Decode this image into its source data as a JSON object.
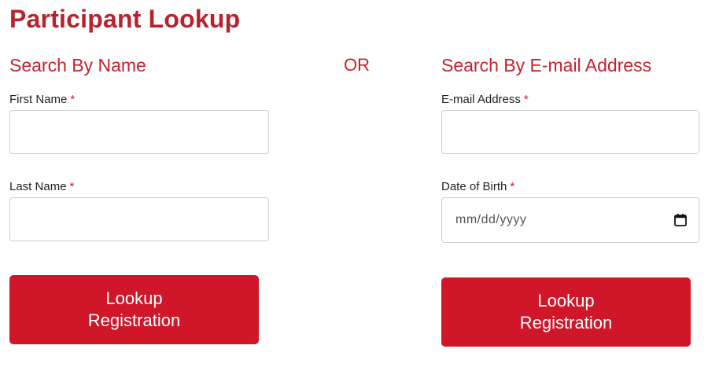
{
  "page": {
    "title": "Participant Lookup",
    "or_text": "OR"
  },
  "by_name": {
    "heading": "Search By Name",
    "first_name_label": "First Name",
    "first_name_value": "",
    "last_name_label": "Last Name",
    "last_name_value": "",
    "required_mark": "*",
    "button_line1": "Lookup",
    "button_line2": "Registration"
  },
  "by_email": {
    "heading": "Search By E-mail Address",
    "email_label": "E-mail Address",
    "email_value": "",
    "dob_label": "Date of Birth",
    "dob_placeholder": "mm/dd/yyyy",
    "required_mark": "*",
    "button_line1": "Lookup",
    "button_line2": "Registration"
  },
  "icons": {
    "date_picker": "calendar-icon"
  },
  "colors": {
    "accent": "#c8202e",
    "button": "#d01629",
    "required": "#d7192a"
  }
}
